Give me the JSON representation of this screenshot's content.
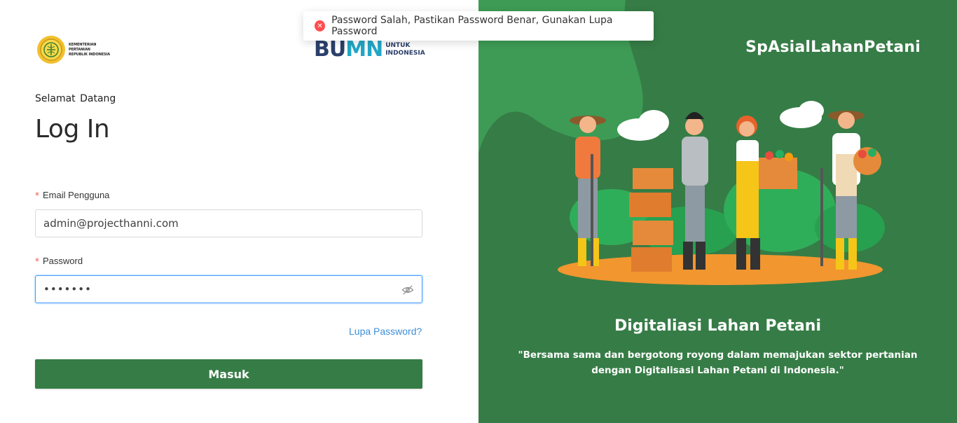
{
  "toast": {
    "icon": "error-circle-icon",
    "message": "Password Salah, Pastikan Password Benar, Gunakan Lupa Password"
  },
  "logos": {
    "kementan_text_line1": "KEMENTERIAN PERTANIAN",
    "kementan_text_line2": "REPUBLIK INDONESIA",
    "bumn_mark_part1": "BU",
    "bumn_mark_part2": "MN",
    "bumn_sub_line1": "UNTUK",
    "bumn_sub_line2": "INDONESIA"
  },
  "login": {
    "welcome": "Selamat  Datang",
    "title": "Log In",
    "email_label": "Email Pengguna",
    "email_value": "admin@projecthanni.com",
    "password_label": "Password",
    "password_value": "•••••••",
    "required_mark": "*",
    "forgot_link": "Lupa Password?",
    "submit_label": "Masuk"
  },
  "promo": {
    "brand": "SpAsialLahanPetani",
    "title": "Digitaliasi Lahan Petani",
    "quote": "\"Bersama sama dan bergotong royong dalam memajukan sektor pertanian dengan Digitalisasi Lahan Petani di Indonesia.\""
  },
  "colors": {
    "primary_green": "#367c46",
    "error_red": "#ff4d4f",
    "link_blue": "#3d8fd9",
    "focus_blue": "#4096ff"
  }
}
